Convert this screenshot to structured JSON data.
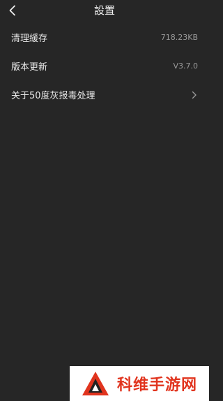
{
  "header": {
    "title": "設置",
    "back_icon": "chevron-left-icon"
  },
  "settings": {
    "items": [
      {
        "label": "清理緩存",
        "value": "718.23KB"
      },
      {
        "label": "版本更新",
        "value": "V3.7.0"
      },
      {
        "label": "关于50度灰报毒处理",
        "accessory_icon": "chevron-right-icon"
      }
    ]
  },
  "watermark": {
    "text": "科维手游网",
    "logo_icon": "triangle-logo-icon",
    "text_color": "#e1341e"
  },
  "theme": {
    "background": "#262626",
    "text": "#ececec",
    "secondary_text": "#9a9a9a"
  }
}
